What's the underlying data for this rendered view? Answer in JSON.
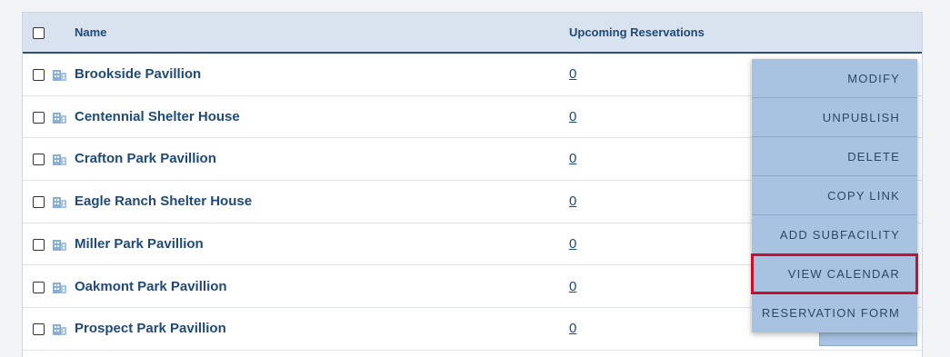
{
  "table": {
    "headers": {
      "name": "Name",
      "upcoming": "Upcoming Reservations"
    },
    "rows": [
      {
        "name": "Brookside Pavillion",
        "upcoming": "0"
      },
      {
        "name": "Centennial Shelter House",
        "upcoming": "0"
      },
      {
        "name": "Crafton Park Pavillion",
        "upcoming": "0"
      },
      {
        "name": "Eagle Ranch Shelter House",
        "upcoming": "0"
      },
      {
        "name": "Miller Park Pavillion",
        "upcoming": "0"
      },
      {
        "name": "Oakmont Park Pavillion",
        "upcoming": "0"
      },
      {
        "name": "Prospect Park Pavillion",
        "upcoming": "0"
      }
    ]
  },
  "context_menu": {
    "items": [
      "MODIFY",
      "UNPUBLISH",
      "DELETE",
      "COPY LINK",
      "ADD SUBFACILITY",
      "VIEW CALENDAR",
      "RESERVATION FORM"
    ],
    "highlighted": "VIEW CALENDAR"
  },
  "icons": {
    "row_icon": "building-icon"
  },
  "colors": {
    "text": "#1f4a78",
    "header_bg": "#d9e3ef",
    "menu_bg": "#a7c3e1",
    "highlight": "#c8102e"
  }
}
